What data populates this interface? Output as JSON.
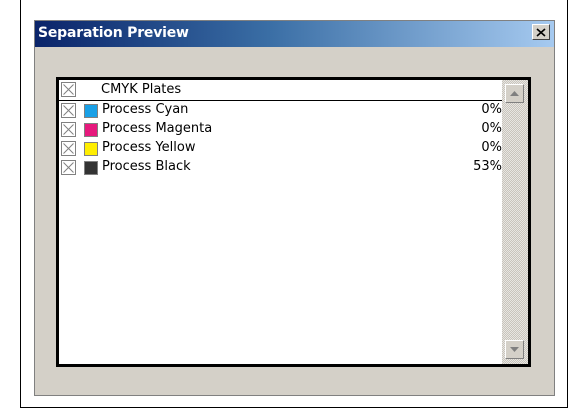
{
  "window": {
    "title": "Separation Preview",
    "close_icon": "close-icon"
  },
  "list": {
    "header": {
      "label": "CMYK Plates",
      "checked": true
    },
    "plates": [
      {
        "label": "Process Cyan",
        "percent": "0%",
        "color": "#1aa0e6",
        "checked": true
      },
      {
        "label": "Process Magenta",
        "percent": "0%",
        "color": "#e6197d",
        "checked": true
      },
      {
        "label": "Process Yellow",
        "percent": "0%",
        "color": "#ffee00",
        "checked": true
      },
      {
        "label": "Process Black",
        "percent": "53%",
        "color": "#333333",
        "checked": true
      }
    ]
  },
  "scrollbar": {
    "up_icon": "scroll-up-arrow-icon",
    "down_icon": "scroll-down-arrow-icon"
  }
}
